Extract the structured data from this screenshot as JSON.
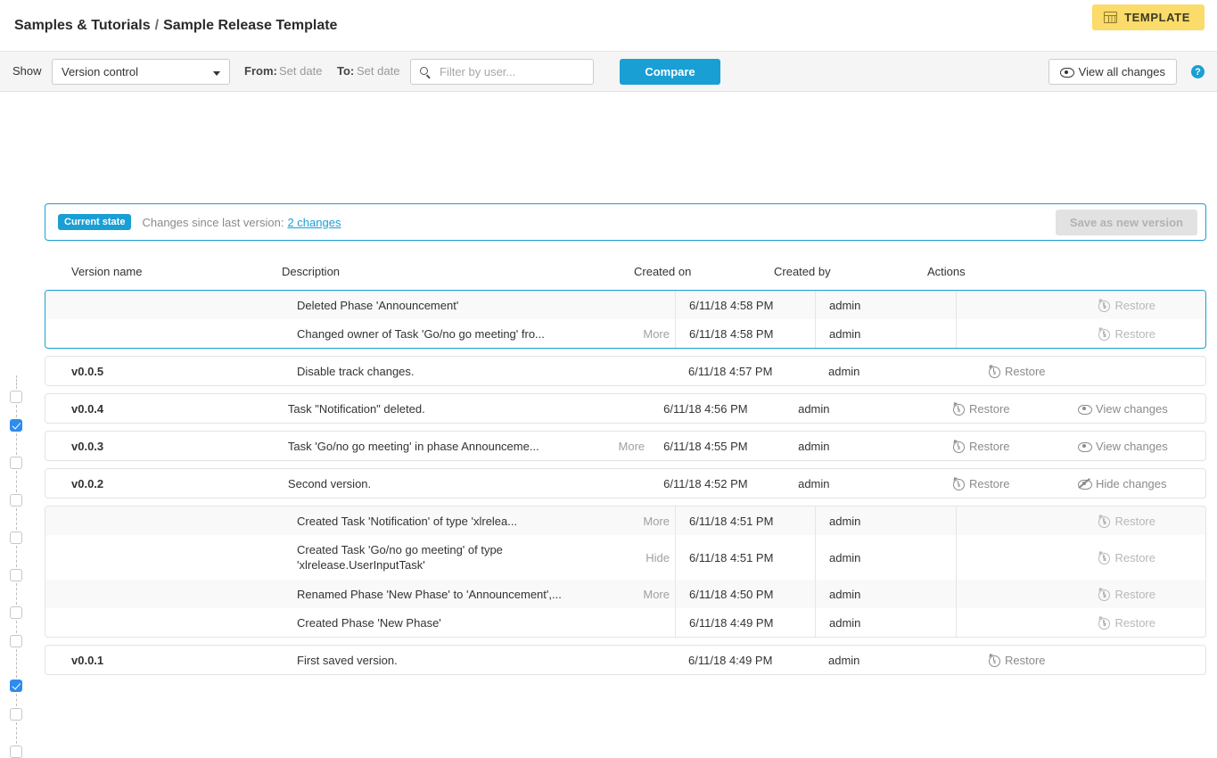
{
  "header": {
    "breadcrumb_parent": "Samples & Tutorials",
    "breadcrumb_separator": "/",
    "breadcrumb_current": "Sample Release Template",
    "template_badge": "TEMPLATE",
    "template_badge_icon": "table-icon",
    "template_badge_color": "#fbdb6a"
  },
  "toolbar": {
    "show_label": "Show",
    "show_value": "Version control",
    "from_label": "From:",
    "from_value": "Set date",
    "to_label": "To:",
    "to_value": "Set date",
    "search_placeholder": "Filter by user...",
    "search_value": "",
    "search_icon": "search-icon",
    "compare_label": "Compare",
    "compare_color": "#1a9fd4",
    "view_all_changes_label": "View all changes",
    "view_all_changes_icon": "eye-icon",
    "help_label": "?",
    "help_icon": "question-circle-icon"
  },
  "banner": {
    "chip": "Current state",
    "text": "Changes since last version:",
    "link": "2 changes",
    "save_label": "Save as new version",
    "save_disabled": true
  },
  "table": {
    "columns": {
      "version": "Version name",
      "description": "Description",
      "created_on": "Created on",
      "created_by": "Created by",
      "actions": "Actions"
    },
    "groups": [
      {
        "selected": true,
        "grouped": true,
        "rows": [
          {
            "checked": false,
            "version": "",
            "description": "Deleted Phase 'Announcement'",
            "more": "",
            "created_on": "6/11/18 4:58 PM",
            "created_by": "admin",
            "restore": "Restore",
            "restore_disabled": true,
            "changes": ""
          },
          {
            "checked": true,
            "version": "",
            "description": "Changed owner of Task 'Go/no go meeting' fro...",
            "more": "More",
            "created_on": "6/11/18 4:58 PM",
            "created_by": "admin",
            "restore": "Restore",
            "restore_disabled": true,
            "changes": ""
          }
        ]
      },
      {
        "selected": false,
        "grouped": false,
        "rows": [
          {
            "checked": false,
            "version": "v0.0.5",
            "description": "Disable track changes.",
            "more": "",
            "created_on": "6/11/18 4:57 PM",
            "created_by": "admin",
            "restore": "Restore",
            "restore_disabled": false,
            "changes": ""
          }
        ]
      },
      {
        "selected": false,
        "grouped": false,
        "rows": [
          {
            "checked": false,
            "version": "v0.0.4",
            "description": "Task \"Notification\" deleted.",
            "more": "",
            "created_on": "6/11/18 4:56 PM",
            "created_by": "admin",
            "restore": "Restore",
            "restore_disabled": false,
            "changes": "View changes",
            "changes_icon": "eye-icon"
          }
        ]
      },
      {
        "selected": false,
        "grouped": false,
        "rows": [
          {
            "checked": false,
            "version": "v0.0.3",
            "description": "Task 'Go/no go meeting' in phase Announceme...",
            "more": "More",
            "created_on": "6/11/18 4:55 PM",
            "created_by": "admin",
            "restore": "Restore",
            "restore_disabled": false,
            "changes": "View changes",
            "changes_icon": "eye-icon"
          }
        ]
      },
      {
        "selected": false,
        "grouped": false,
        "rows": [
          {
            "checked": false,
            "version": "v0.0.2",
            "description": "Second version.",
            "more": "",
            "created_on": "6/11/18 4:52 PM",
            "created_by": "admin",
            "restore": "Restore",
            "restore_disabled": false,
            "changes": "Hide changes",
            "changes_icon": "eye-slash-icon"
          }
        ]
      },
      {
        "selected": false,
        "grouped": true,
        "rows": [
          {
            "checked": false,
            "version": "",
            "description": "Created Task 'Notification' of type 'xlrelea...",
            "more": "More",
            "created_on": "6/11/18 4:51 PM",
            "created_by": "admin",
            "restore": "Restore",
            "restore_disabled": true,
            "changes": ""
          },
          {
            "checked": false,
            "version": "",
            "description": "Created Task 'Go/no go meeting' of type 'xlrelease.UserInputTask'",
            "more": "Hide",
            "created_on": "6/11/18 4:51 PM",
            "created_by": "admin",
            "restore": "Restore",
            "restore_disabled": true,
            "changes": ""
          },
          {
            "checked": true,
            "version": "",
            "description": "Renamed Phase 'New Phase' to 'Announcement',...",
            "more": "More",
            "created_on": "6/11/18 4:50 PM",
            "created_by": "admin",
            "restore": "Restore",
            "restore_disabled": true,
            "changes": ""
          },
          {
            "checked": false,
            "version": "",
            "description": "Created Phase 'New Phase'",
            "more": "",
            "created_on": "6/11/18 4:49 PM",
            "created_by": "admin",
            "restore": "Restore",
            "restore_disabled": true,
            "changes": ""
          }
        ]
      },
      {
        "selected": false,
        "grouped": false,
        "rows": [
          {
            "checked": false,
            "version": "v0.0.1",
            "description": "First saved version.",
            "more": "",
            "created_on": "6/11/18 4:49 PM",
            "created_by": "admin",
            "restore": "Restore",
            "restore_disabled": false,
            "changes": ""
          }
        ]
      }
    ]
  }
}
